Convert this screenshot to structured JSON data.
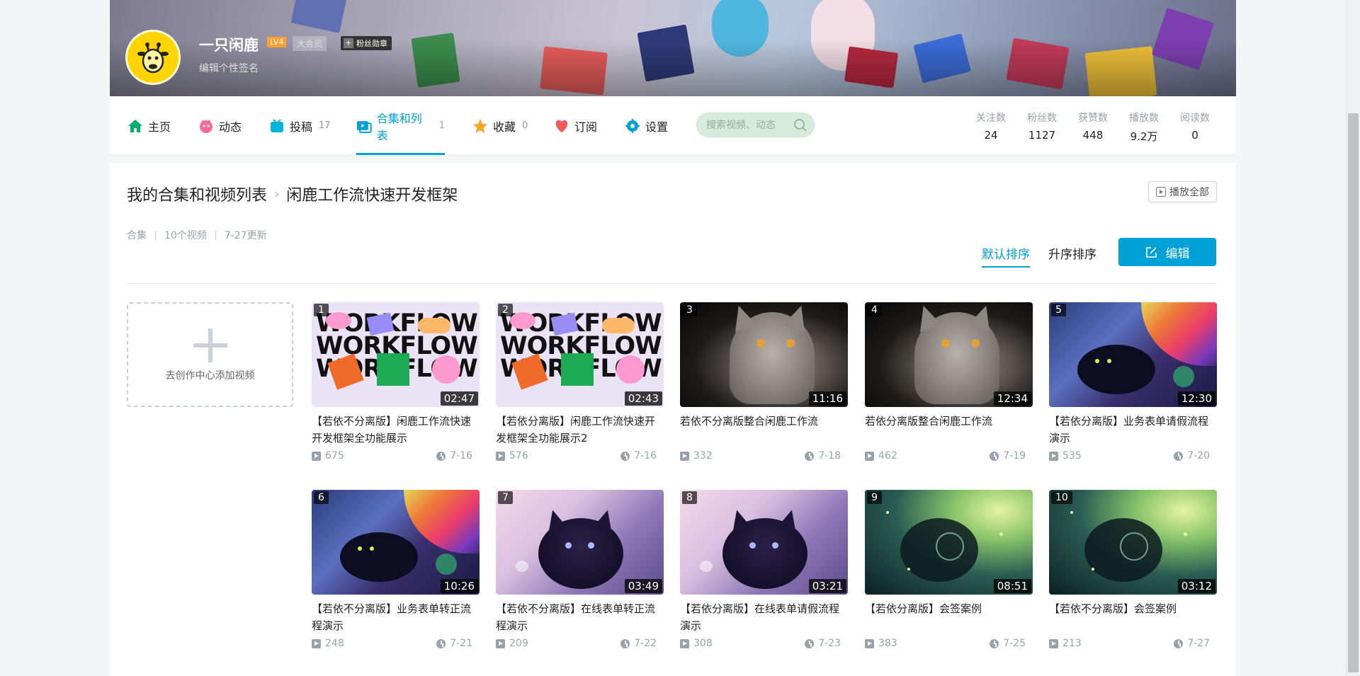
{
  "profile": {
    "name": "一只闲鹿",
    "level": "LV4",
    "vip": "大会员",
    "fan_badge": "粉丝勋章",
    "signature": "编辑个性签名"
  },
  "nav": {
    "items": [
      {
        "label": "主页",
        "count": "",
        "icon": "home-icon"
      },
      {
        "label": "动态",
        "count": "",
        "icon": "dynamic-icon"
      },
      {
        "label": "投稿",
        "count": "17",
        "icon": "upload-icon"
      },
      {
        "label": "合集和列表",
        "count": "1",
        "icon": "collection-icon"
      },
      {
        "label": "收藏",
        "count": "0",
        "icon": "favorite-icon"
      },
      {
        "label": "订阅",
        "count": "",
        "icon": "subscribe-icon"
      },
      {
        "label": "设置",
        "count": "",
        "icon": "settings-icon"
      }
    ],
    "active_index": 3,
    "search_placeholder": "搜索视频、动态"
  },
  "stats": [
    {
      "label": "关注数",
      "value": "24"
    },
    {
      "label": "粉丝数",
      "value": "1127"
    },
    {
      "label": "获赞数",
      "value": "448"
    },
    {
      "label": "播放数",
      "value": "9.2万"
    },
    {
      "label": "阅读数",
      "value": "0"
    }
  ],
  "collection": {
    "breadcrumb_root": "我的合集和视频列表",
    "breadcrumb_current": "闲鹿工作流快速开发框架",
    "play_all": "播放全部",
    "type": "合集",
    "video_count": "10个视频",
    "updated": "7-27更新",
    "sort_default": "默认排序",
    "sort_asc": "升序排序",
    "edit": "编辑",
    "add_video": "去创作中心添加视频"
  },
  "videos": [
    {
      "index": "1",
      "duration": "02:47",
      "title": "【若依不分离版】闲鹿工作流快速开发框架全功能展示",
      "plays": "675",
      "date": "7-16",
      "art": "workflow"
    },
    {
      "index": "2",
      "duration": "02:43",
      "title": "【若依分离版】闲鹿工作流快速开发框架全功能展示2",
      "plays": "576",
      "date": "7-16",
      "art": "workflow"
    },
    {
      "index": "3",
      "duration": "11:16",
      "title": "若依不分离版整合闲鹿工作流",
      "plays": "332",
      "date": "7-18",
      "art": "cat"
    },
    {
      "index": "4",
      "duration": "12:34",
      "title": "若依分离版整合闲鹿工作流",
      "plays": "462",
      "date": "7-19",
      "art": "cat"
    },
    {
      "index": "5",
      "duration": "12:30",
      "title": "【若依分离版】业务表单请假流程演示",
      "plays": "535",
      "date": "7-20",
      "art": "galaxy"
    },
    {
      "index": "6",
      "duration": "10:26",
      "title": "【若依不分离版】业务表单转正流程演示",
      "plays": "248",
      "date": "7-21",
      "art": "galaxy"
    },
    {
      "index": "7",
      "duration": "03:49",
      "title": "【若依不分离版】在线表单转正流程演示",
      "plays": "209",
      "date": "7-22",
      "art": "purple"
    },
    {
      "index": "8",
      "duration": "03:21",
      "title": "【若依分离版】在线表单请假流程演示",
      "plays": "308",
      "date": "7-23",
      "art": "purple"
    },
    {
      "index": "9",
      "duration": "08:51",
      "title": "【若依分离版】会签案例",
      "plays": "383",
      "date": "7-25",
      "art": "green"
    },
    {
      "index": "10",
      "duration": "03:12",
      "title": "【若依不分离版】会签案例",
      "plays": "213",
      "date": "7-27",
      "art": "green"
    }
  ],
  "colors": {
    "accent": "#00a1d6",
    "avatar_bg": "#ffd400",
    "level_badge": "#ff9f2d"
  }
}
